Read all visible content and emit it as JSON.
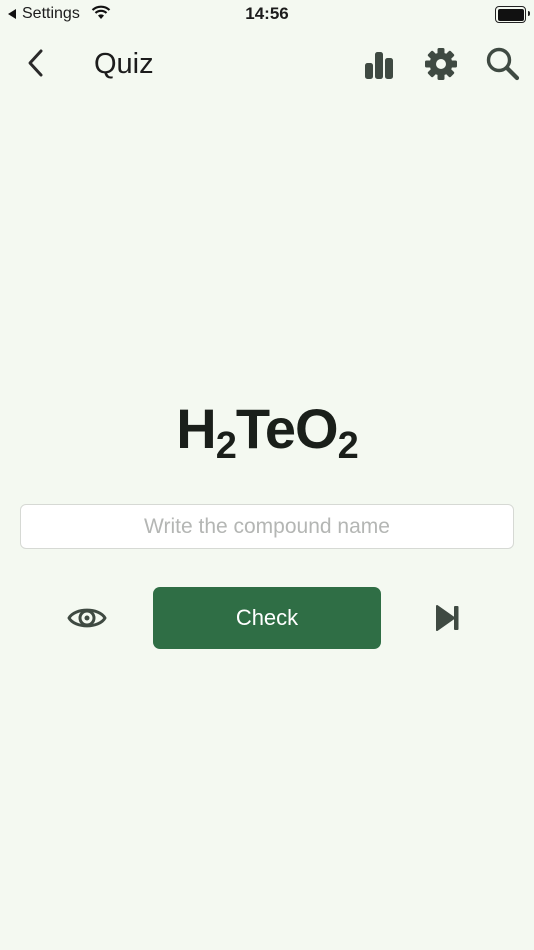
{
  "status_bar": {
    "back_app": "Settings",
    "time": "14:56"
  },
  "nav": {
    "title": "Quiz",
    "icons": [
      "back-chevron-icon",
      "bar-chart-icon",
      "gear-icon",
      "search-icon"
    ]
  },
  "quiz": {
    "formula_parts": {
      "el1": "H",
      "sub1": "2",
      "el2": "TeO",
      "sub2": "2"
    },
    "answer_placeholder": "Write the compound name",
    "answer_value": "",
    "check_label": "Check",
    "icons": [
      "eye-icon",
      "skip-forward-icon"
    ]
  },
  "colors": {
    "background": "#f4f9f1",
    "accent": "#2f6e45",
    "icon": "#3f4a42"
  }
}
